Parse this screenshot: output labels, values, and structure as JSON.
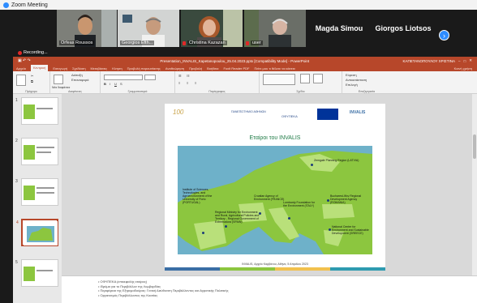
{
  "zoom": {
    "title": "Zoom Meeting",
    "recording": "Recording..."
  },
  "participants": [
    {
      "name": "Orfeas Roussos"
    },
    {
      "name": "Georgios Efth..."
    },
    {
      "name": "Christina Kazazan"
    },
    {
      "name": "user"
    },
    {
      "name": ""
    }
  ],
  "named_tiles": [
    "Magda Simou",
    "Giorgos Liotsos"
  ],
  "next_icon": "chevron-right-icon",
  "ppt": {
    "title": "Presentation_INVALIS_Kapetanopoulou_25.04.2023.pptx [Compatibility Mode] - PowerPoint",
    "user": "ΚΑΠΕΤΑΝΟΠΟΥΛΟΥ ΧΡΙΣΤΙΝΑ",
    "tabs": [
      "Αρχείο",
      "Κεντρική",
      "Εισαγωγή",
      "Σχεδίαση",
      "Μεταβάσεις",
      "Κίνηση",
      "Προβολή παρουσίασης",
      "Αναθεώρηση",
      "Προβολή",
      "Βοήθεια",
      "Foxit Reader PDF",
      "Πείτε μου τι θέλετε να κάνετε"
    ],
    "share": "Κοινή χρήση",
    "ribbon_groups": [
      "Πρόχειρο",
      "Διαφάνειες",
      "Γραμματοσειρά",
      "Παράγραφος",
      "Σχέδιο",
      "Επεξεργασία"
    ],
    "ribbon_buttons": {
      "layout": "Διάταξη",
      "reset": "Επαναφορά",
      "new_slide": "Νέα διαφάνεια",
      "find": "Εύρεση",
      "replace": "Αντικατάσταση",
      "select": "Επιλογή"
    },
    "slide_numbers": [
      "1",
      "2",
      "3",
      "4",
      "5"
    ],
    "active_slide": "4"
  },
  "slide": {
    "logo_100": "100",
    "org_line1": "ΠΑΝΕΠΙΣΤΗΜΙΟ ΑΘΗΝΩΝ",
    "org_line2": "OΦΥΠΕΚΑ",
    "invalis": "INVALIS",
    "title": "Εταίροι του INVALIS",
    "labels": [
      "Zemgale Planning Region (LATVIA)",
      "Institute of Sciences, Technologies, and Agroenvironment of the University of Porto (PORTUGAL)",
      "Regional Ministry for Environment and Rural, Agricultural Policies and Territory - Regional Government of Extremadura (SPAIN)",
      "Croatian Agency of Environment (FRANCE)",
      "Lombardy Foundation for the Environment (ITALY)",
      "Bucharest-Ilfov Regional Development Agency (ROMANIA)",
      "National Center for Environment and Sustainable Development (GREECE)"
    ],
    "footer": "INVALIS, Αρχείο Καρβάνου, Αθήνα, 5 Απριλίου 2023"
  },
  "notes": [
    "ΟΦΥΠΕΚΑ (επικεφαλής εταίρος)",
    "Ιδρύμα για το Περιβάλλον της Λομβαρδίας",
    "Περιφέρεια της Εξτρεμαδούρας: Γενική Διεύθυνση Περιβάλλοντος και Αγροτικής Πολιτικής",
    "Οργανισμός Περιβάλλοντος της Κοατίας"
  ],
  "colors": {
    "ppt_red": "#b7472a",
    "zoom_blue": "#2d8cff",
    "slide_green": "#8cc63f"
  }
}
